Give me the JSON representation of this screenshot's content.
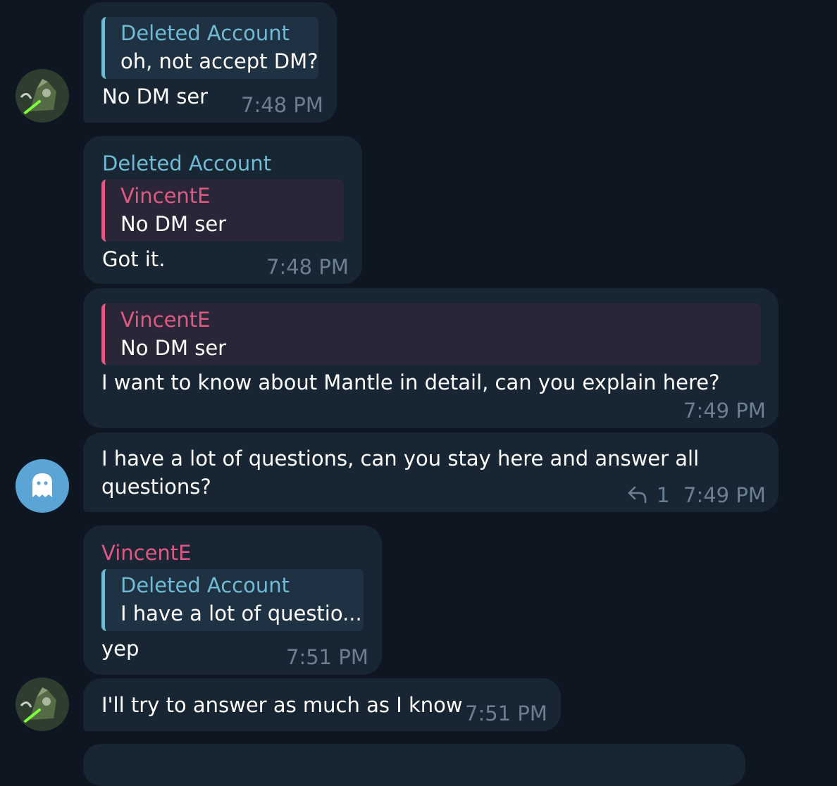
{
  "messages": [
    {
      "reply_name": "Deleted Account",
      "reply_text": "oh, not accept DM?",
      "text": "No DM ser",
      "time": "7:48 PM"
    },
    {
      "sender": "Deleted Account",
      "reply_name": "VincentE",
      "reply_text": "No DM ser",
      "text": "Got it.",
      "time": "7:48 PM"
    },
    {
      "reply_name": "VincentE",
      "reply_text": "No DM ser",
      "text": "I want to know about Mantle in detail, can you explain here?",
      "time": "7:49 PM"
    },
    {
      "text_line1": "I have a lot of questions, can you stay here and answer all",
      "text_line2": "questions?",
      "reply_count": "1",
      "time": "7:49 PM"
    },
    {
      "sender": "VincentE",
      "reply_name": "Deleted Account",
      "reply_text": "I have a lot of questio...",
      "text": "yep",
      "time": "7:51 PM"
    },
    {
      "text": "I'll try to answer as much as I know",
      "time": "7:51 PM"
    }
  ],
  "colors": {
    "background": "#0e1621",
    "bubble": "#182533",
    "deleted_account": "#71bad4",
    "vincente": "#e05884",
    "time": "#6b7f93",
    "ghost_avatar": "#5aa4d6"
  },
  "icons": {
    "ghost": "ghost-icon",
    "reply": "reply-arrow-icon",
    "knight_avatar": "avatar-knight-image"
  }
}
